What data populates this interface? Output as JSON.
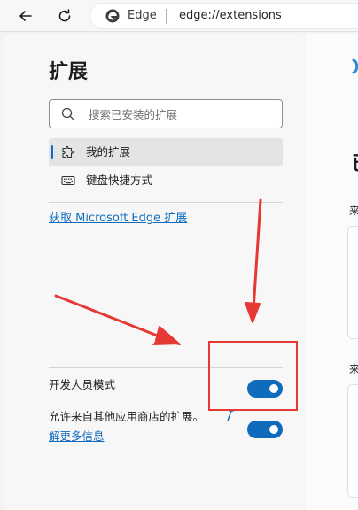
{
  "toolbar": {
    "site_name": "Edge",
    "url": "edge://extensions"
  },
  "sidebar": {
    "title": "扩展",
    "search_placeholder": "搜索已安装的扩展",
    "nav": [
      {
        "label": "我的扩展",
        "icon": "puzzle-icon",
        "active": true
      },
      {
        "label": "键盘快捷方式",
        "icon": "keyboard-icon",
        "active": false
      }
    ],
    "get_extensions_link": "获取 Microsoft Edge 扩展",
    "developer_mode_label": "开发人员模式",
    "developer_mode_on": true,
    "allow_stores_label": "允许来自其他应用商店的扩展。",
    "allow_stores_on": true,
    "learn_more_link": "解更多信息"
  },
  "content": {
    "heading_partial": "已",
    "subheading1_partial": "来",
    "subheading2_partial": "来"
  },
  "colors": {
    "accent": "#0f6cbd",
    "annotation": "#e53935"
  }
}
